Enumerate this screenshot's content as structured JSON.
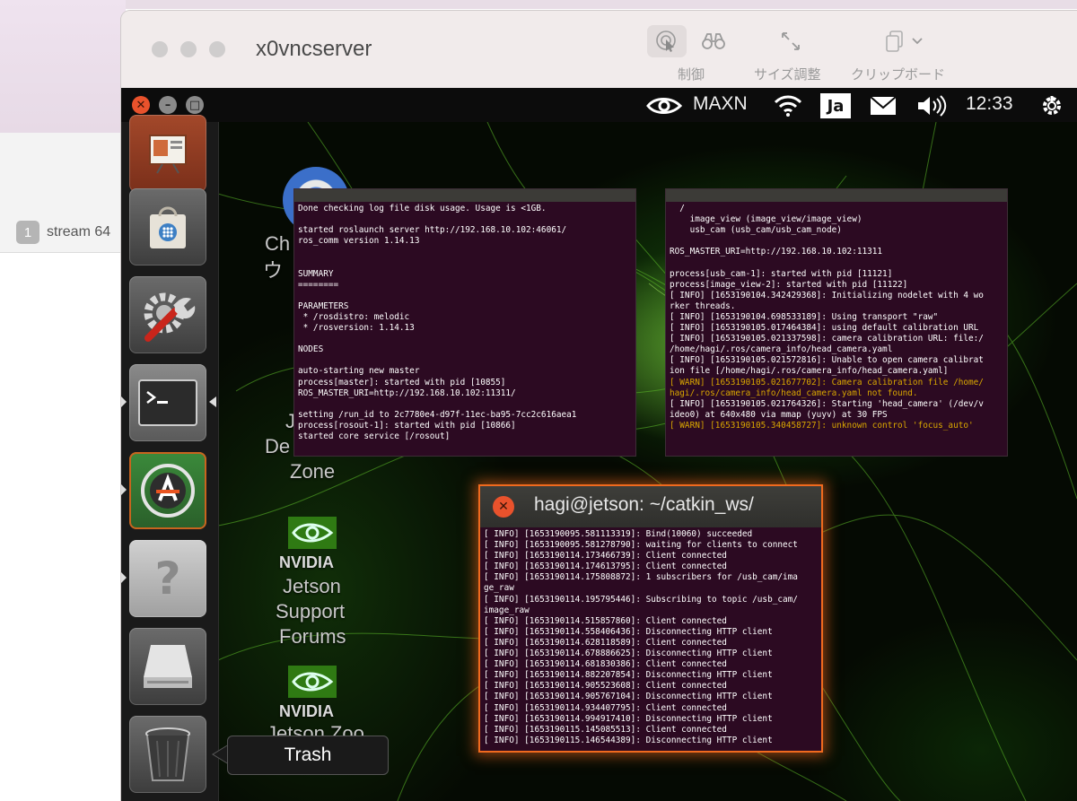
{
  "mac": {
    "tab_badge": "1",
    "tab_label": "stream 64"
  },
  "window": {
    "title": "x0vncserver",
    "toolbar": {
      "control_label": "制御",
      "resize_label": "サイズ調整",
      "clipboard_label": "クリップボード"
    }
  },
  "panel": {
    "power_mode": "MAXN",
    "input_method": "Ja",
    "clock": "12:33"
  },
  "launcher": {
    "items": [
      "presentation",
      "software-center",
      "system-settings",
      "terminal",
      "software-updater",
      "help",
      "drive",
      "trash"
    ]
  },
  "desktop_icons": {
    "chromium_label_1": "Ch",
    "chromium_label_2": "ウ",
    "devzone_label_1": "J",
    "devzone_label_2": "De",
    "devzone_label_3": "Zone",
    "forums_brand": "NVIDIA",
    "forums_label_1": "Jetson",
    "forums_label_2": "Support",
    "forums_label_3": "Forums",
    "zoo_brand": "NVIDIA",
    "zoo_label": "Jetson Zoo"
  },
  "tooltip": "Trash",
  "terminal_left": {
    "lines": [
      "Done checking log file disk usage. Usage is <1GB.",
      "",
      "started roslaunch server http://192.168.10.102:46061/",
      "ros_comm version 1.14.13",
      "",
      "",
      "SUMMARY",
      "========",
      "",
      "PARAMETERS",
      " * /rosdistro: melodic",
      " * /rosversion: 1.14.13",
      "",
      "NODES",
      "",
      "auto-starting new master",
      "process[master]: started with pid [10855]",
      "ROS_MASTER_URI=http://192.168.10.102:11311/",
      "",
      "setting /run_id to 2c7780e4-d97f-11ec-ba95-7cc2c616aea1",
      "process[rosout-1]: started with pid [10866]",
      "started core service [/rosout]"
    ]
  },
  "terminal_right": {
    "lines": [
      "  /",
      "    image_view (image_view/image_view)",
      "    usb_cam (usb_cam/usb_cam_node)",
      "",
      "ROS_MASTER_URI=http://192.168.10.102:11311",
      "",
      "process[usb_cam-1]: started with pid [11121]",
      "process[image_view-2]: started with pid [11122]",
      "[ INFO] [1653190104.342429368]: Initializing nodelet with 4 wo",
      "rker threads.",
      "[ INFO] [1653190104.698533189]: Using transport \"raw\"",
      "[ INFO] [1653190105.017464384]: using default calibration URL",
      "[ INFO] [1653190105.021337598]: camera calibration URL: file:/",
      "/home/hagi/.ros/camera_info/head_camera.yaml",
      "[ INFO] [1653190105.021572816]: Unable to open camera calibrat",
      "ion file [/home/hagi/.ros/camera_info/head_camera.yaml]",
      "[ WARN] [1653190105.021677702]: Camera calibration file /home/",
      "hagi/.ros/camera_info/head_camera.yaml not found.",
      "[ INFO] [1653190105.021764326]: Starting 'head_camera' (/dev/v",
      "ideo0) at 640x480 via mmap (yuyv) at 30 FPS",
      "[ WARN] [1653190105.340458727]: unknown control 'focus_auto'"
    ]
  },
  "terminal_front": {
    "title": "hagi@jetson: ~/catkin_ws/",
    "lines": [
      "[ INFO] [1653190095.581113319]: Bind(10060) succeeded",
      "[ INFO] [1653190095.581278790]: waiting for clients to connect",
      "[ INFO] [1653190114.173466739]: Client connected",
      "[ INFO] [1653190114.174613795]: Client connected",
      "[ INFO] [1653190114.175808872]: 1 subscribers for /usb_cam/ima",
      "ge_raw",
      "[ INFO] [1653190114.195795446]: Subscribing to topic /usb_cam/",
      "image_raw",
      "[ INFO] [1653190114.515857860]: Client connected",
      "[ INFO] [1653190114.558406436]: Disconnecting HTTP client",
      "[ INFO] [1653190114.628118589]: Client connected",
      "[ INFO] [1653190114.678886625]: Disconnecting HTTP client",
      "[ INFO] [1653190114.681830386]: Client connected",
      "[ INFO] [1653190114.882207854]: Disconnecting HTTP client",
      "[ INFO] [1653190114.905523608]: Client connected",
      "[ INFO] [1653190114.905767104]: Disconnecting HTTP client",
      "[ INFO] [1653190114.934407795]: Client connected",
      "[ INFO] [1653190114.994917410]: Disconnecting HTTP client",
      "[ INFO] [1653190115.145085513]: Client connected",
      "[ INFO] [1653190115.146544389]: Disconnecting HTTP client"
    ]
  },
  "colors": {
    "terminal_bg": "#2c0a22",
    "warn": "#d9a700",
    "close_orange": "#e9522c",
    "focus_glow": "#f06a1e"
  }
}
